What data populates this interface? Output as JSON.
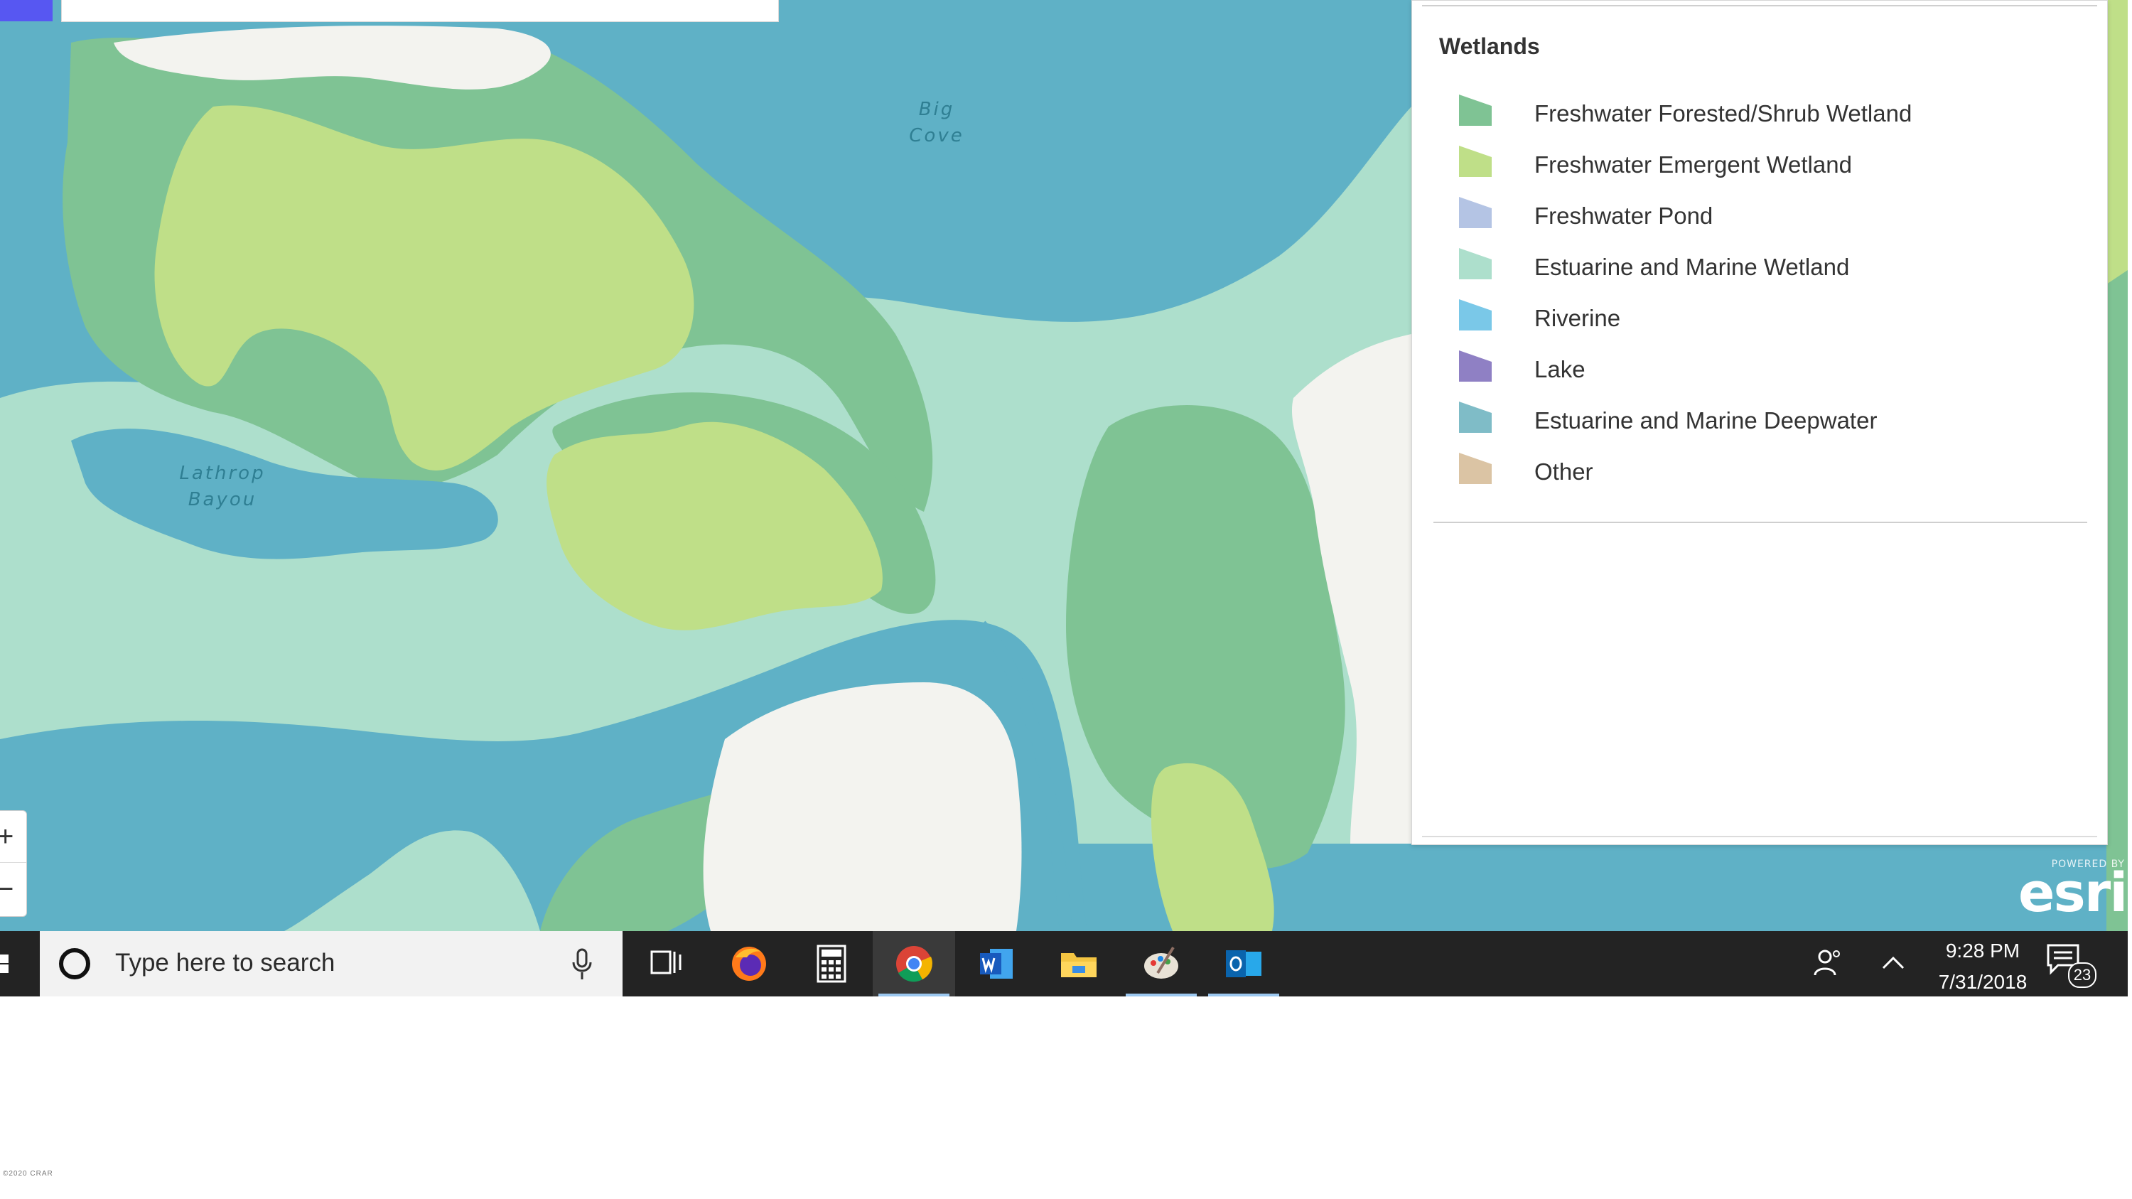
{
  "colors": {
    "deepwater": "#5fb1c6",
    "estuarine_wetland": "#addfcc",
    "forested_shrub": "#7fc394",
    "emergent": "#bfdf88",
    "upland": "#f3f3ef",
    "freshwater_pond": "#b4c4e4",
    "riverine": "#7ac8e8",
    "lake": "#8f80c4",
    "estuarine_deepwater": "#7fbcc7",
    "other": "#dbc4a4",
    "taskbar": "#232323"
  },
  "map": {
    "labels": {
      "big_cove": "Big\nCove",
      "lathrop_bayou": "Lathrop\nBayou"
    },
    "zoom_in": "+",
    "zoom_out": "−"
  },
  "legend": {
    "title": "Wetlands",
    "items": [
      {
        "label": "Freshwater Forested/Shrub Wetland",
        "color": "#7fc394"
      },
      {
        "label": "Freshwater Emergent Wetland",
        "color": "#bfdf88"
      },
      {
        "label": "Freshwater Pond",
        "color": "#b4c4e4"
      },
      {
        "label": "Estuarine and Marine Wetland",
        "color": "#addfcc"
      },
      {
        "label": "Riverine",
        "color": "#7ac8e8"
      },
      {
        "label": "Lake",
        "color": "#8f80c4"
      },
      {
        "label": "Estuarine and Marine Deepwater",
        "color": "#7fbcc7"
      },
      {
        "label": "Other",
        "color": "#dbc4a4"
      }
    ]
  },
  "attribution": {
    "powered_by": "POWERED BY",
    "logo": "esri"
  },
  "taskbar": {
    "search_placeholder": "Type here to search",
    "apps": [
      "task-view",
      "firefox",
      "calculator",
      "chrome",
      "word",
      "file-explorer",
      "paint",
      "outlook"
    ],
    "time": "9:28 PM",
    "date": "7/31/2018",
    "notification_count": "23"
  },
  "footer": "©2020 CRAR"
}
